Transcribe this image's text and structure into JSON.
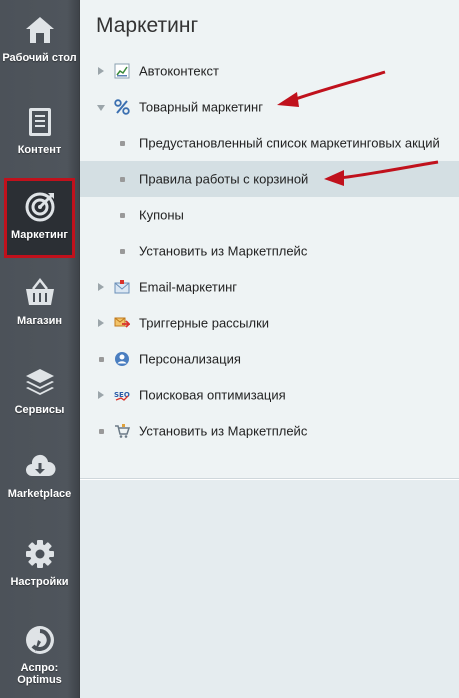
{
  "sidebar": {
    "items": [
      {
        "label": "Рабочий стол",
        "icon": "home-icon"
      },
      {
        "label": "Контент",
        "icon": "document-icon"
      },
      {
        "label": "Маркетинг",
        "icon": "target-icon"
      },
      {
        "label": "Магазин",
        "icon": "basket-icon"
      },
      {
        "label": "Сервисы",
        "icon": "layers-icon"
      },
      {
        "label": "Marketplace",
        "icon": "cloud-download-icon"
      },
      {
        "label": "Настройки",
        "icon": "gear-icon"
      },
      {
        "label": "Аспро: Optimus",
        "icon": "aspro-logo-icon"
      }
    ],
    "active_index": 2
  },
  "main": {
    "title": "Маркетинг",
    "menu": [
      {
        "label": "Автоконтекст",
        "icon": "chart-icon",
        "expander": "collapsed"
      },
      {
        "label": "Товарный маркетинг",
        "icon": "percent-icon",
        "expander": "expanded"
      },
      {
        "label": "Предустановленный список маркетинговых акций",
        "sub": true
      },
      {
        "label": "Правила работы с корзиной",
        "sub": true,
        "selected": true
      },
      {
        "label": "Купоны",
        "sub": true
      },
      {
        "label": "Установить из Маркетплейс",
        "sub": true
      },
      {
        "label": "Email-маркетинг",
        "icon": "email-icon",
        "expander": "collapsed"
      },
      {
        "label": "Триггерные рассылки",
        "icon": "trigger-mail-icon",
        "expander": "collapsed"
      },
      {
        "label": "Персонализация",
        "icon": "person-icon",
        "expander": "none"
      },
      {
        "label": "Поисковая оптимизация",
        "icon": "seo-icon",
        "expander": "collapsed"
      },
      {
        "label": "Установить из Маркетплейс",
        "icon": "cart-icon",
        "expander": "none"
      }
    ]
  },
  "colors": {
    "accent_red": "#c0111c",
    "sidebar_bg": "#4b5158"
  }
}
